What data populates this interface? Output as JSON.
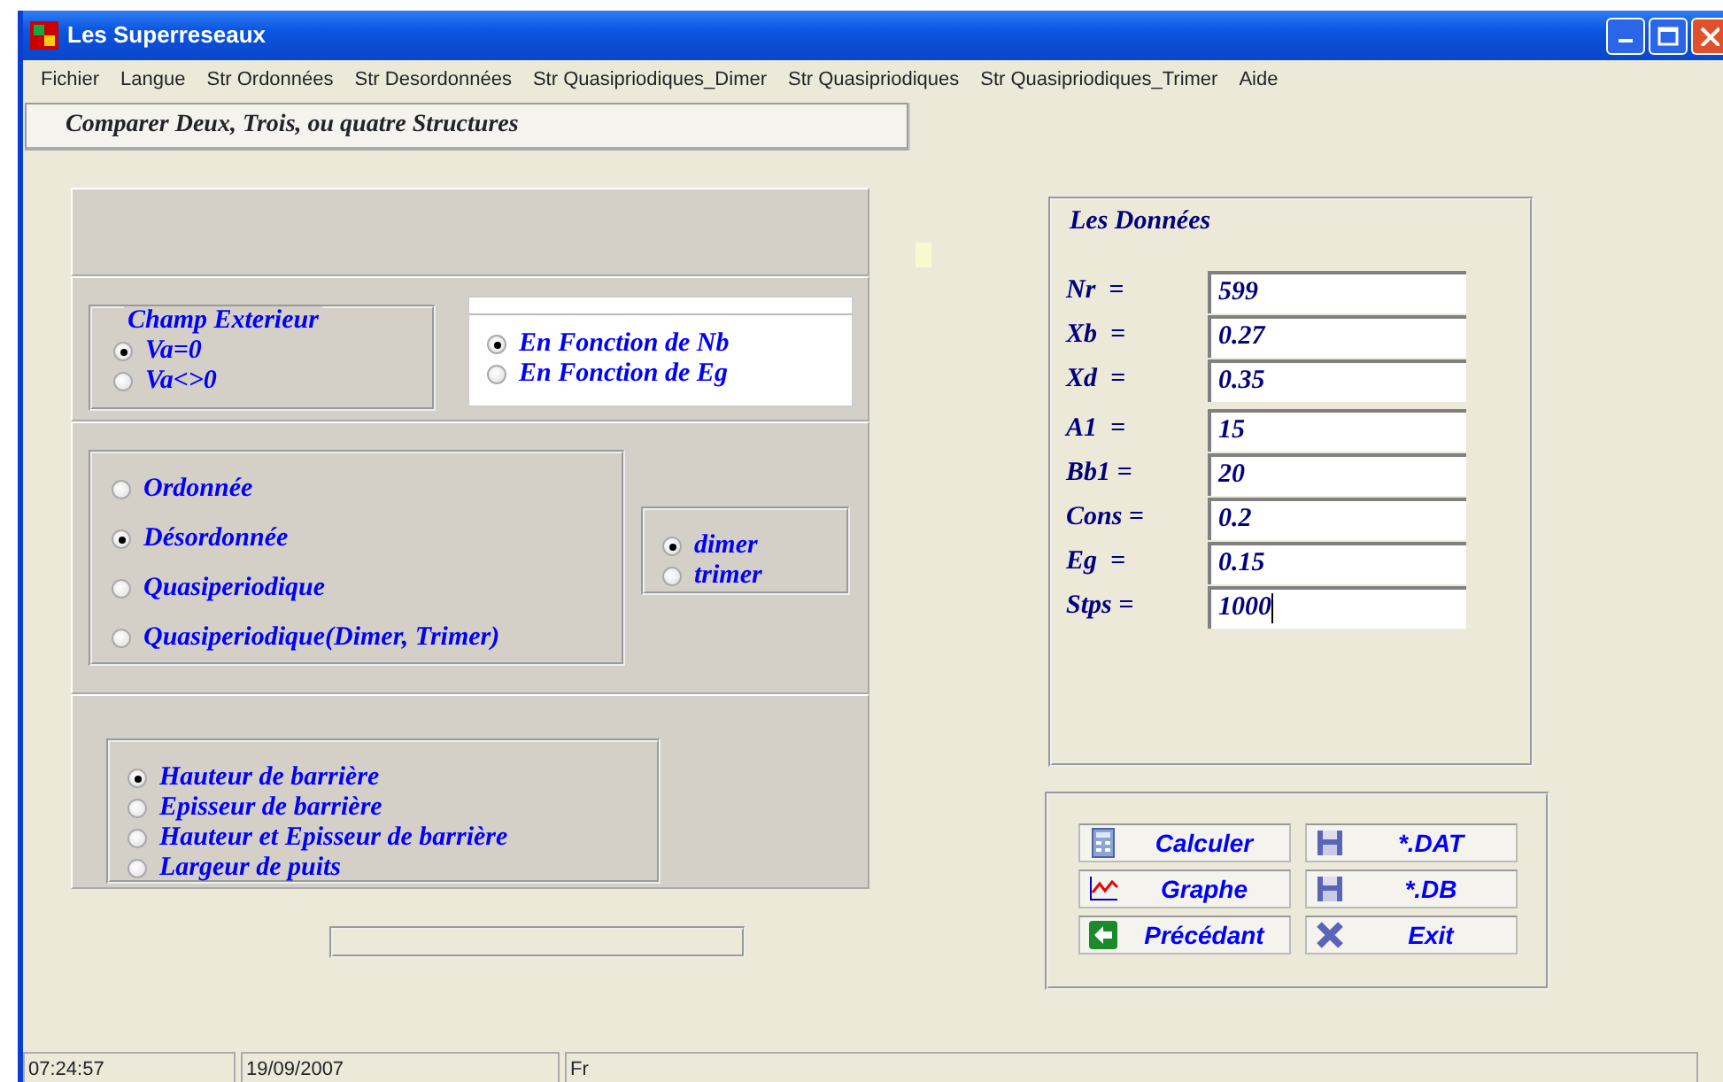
{
  "window": {
    "title": "Les Superreseaux"
  },
  "menu": [
    "Fichier",
    "Langue",
    "Str Ordonnées",
    "Str Desordonnées",
    "Str Quasipriodiques_Dimer",
    "Str Quasipriodiques",
    "Str Quasipriodiques_Trimer",
    "Aide"
  ],
  "tab": {
    "label": "Comparer  Deux, Trois, ou quatre  Structures"
  },
  "champ": {
    "title": "Champ Exterieur",
    "options": [
      {
        "label": "Va=0",
        "selected": true
      },
      {
        "label": "Va<>0",
        "selected": false
      }
    ]
  },
  "fonction": {
    "options": [
      {
        "label": "En Fonction de Nb",
        "selected": true
      },
      {
        "label": "En Fonction de Eg",
        "selected": false
      }
    ]
  },
  "structures": [
    {
      "label": "Ordonnée",
      "selected": false
    },
    {
      "label": "Désordonnée",
      "selected": true
    },
    {
      "label": "Quasiperiodique",
      "selected": false
    },
    {
      "label": "Quasiperiodique(Dimer, Trimer)",
      "selected": false
    }
  ],
  "polymer": [
    {
      "label": "dimer",
      "selected": true
    },
    {
      "label": "trimer",
      "selected": false
    }
  ],
  "barriere": [
    {
      "label": "Hauteur de barrière",
      "selected": true
    },
    {
      "label": "Episseur de barrière",
      "selected": false
    },
    {
      "label": "Hauteur et Episseur de barrière",
      "selected": false
    },
    {
      "label": "Largeur de puits",
      "selected": false
    }
  ],
  "donnees": {
    "title": "Les Données",
    "fields": [
      {
        "label": "Nr  =",
        "value": "599",
        "focused": false
      },
      {
        "label": "Xb  =",
        "value": "0.27",
        "focused": false
      },
      {
        "label": "Xd  =",
        "value": "0.35",
        "focused": false
      },
      {
        "label": "A1  =",
        "value": "15",
        "focused": false
      },
      {
        "label": "Bb1 =",
        "value": "20",
        "focused": false
      },
      {
        "label": "Cons =",
        "value": "0.2",
        "focused": false
      },
      {
        "label": "Eg  =",
        "value": "0.15",
        "focused": false
      },
      {
        "label": "Stps =",
        "value": "1000",
        "focused": true
      }
    ]
  },
  "buttons": [
    {
      "label": "Calculer",
      "kind": "calculator"
    },
    {
      "label": "*.DAT",
      "kind": "save"
    },
    {
      "label": "Graphe",
      "kind": "chart"
    },
    {
      "label": "*.DB",
      "kind": "save"
    },
    {
      "label": "Précédant",
      "kind": "back"
    },
    {
      "label": "Exit",
      "kind": "exit"
    }
  ],
  "status_bar": [
    "07:24:57",
    "19/09/2007",
    "Fr"
  ]
}
